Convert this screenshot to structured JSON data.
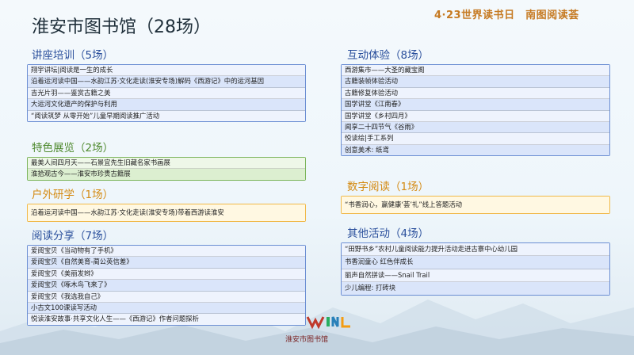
{
  "header": {
    "topbar": "4·23世界读书日　南图阅读荟",
    "title": "淮安市图书馆（28场）"
  },
  "sections": {
    "lecture": {
      "title": "讲座培训（5场）",
      "items": [
        "翔宇讲坛|阅读是一生的成长",
        "沿着运河读中国——水韵江苏·文化走读(淮安专场)解码《西游记》中的运河基因",
        "吉光片羽——鉴赏古籍之美",
        "大运河文化遗产的保护与利用",
        "“阅读筑梦 从零开始”儿童早期阅读推广活动"
      ]
    },
    "exhibition": {
      "title": "特色展览（2场）",
      "items": [
        "最美人间四月天——石景宜先生旧藏名家书画展",
        "淮拾观古今——淮安市珍贵古籍展"
      ]
    },
    "outdoor": {
      "title": "户外研学（1场）",
      "items": [
        "沿着运河读中国——水韵江苏·文化走读(淮安专场)带着西游读淮安"
      ]
    },
    "reading": {
      "title": "阅读分享（7场）",
      "items": [
        "爱阅宝贝《当动物有了手机》",
        "爱阅宝贝《自然美育-蔺公英信差》",
        "爱阅宝贝《美丽发辫》",
        "爱阅宝贝《啄木鸟飞来了》",
        "爱阅宝贝《我选我自己》",
        "小古文100课读写活动",
        "悦读淮安故事·共享文化人生——《西游记》作者问题探析"
      ]
    },
    "interactive": {
      "title": "互动体验（8场）",
      "items": [
        "西游集市——大圣的藏宝阁",
        "古籍装帧体验活动",
        "古籍修复体验活动",
        "国学讲堂《江南春》",
        "国学讲堂《乡村四月》",
        "闻享二十四节气《谷雨》",
        "悦读绘|手工系列",
        "创意美术: 纸鸢"
      ]
    },
    "digital": {
      "title": "数字阅读（1场）",
      "items": [
        "“书香润心，赢健康‘荟’礼”线上答题活动"
      ]
    },
    "other": {
      "title": "其他活动（4场）",
      "items": [
        "“田野书乡”农村儿童阅读能力提升活动走进古寨中心幼儿园",
        "书香润童心 红色伴成长",
        "丽声自然拼读——Snail Trail",
        "少儿编程: 打砖块"
      ]
    }
  },
  "footer": {
    "logo_text": "淮安市图书馆"
  },
  "colors": {
    "blue": "#6b8ed3",
    "green": "#7bb45a",
    "orange": "#f0b848",
    "topbar": "#c67a22"
  }
}
